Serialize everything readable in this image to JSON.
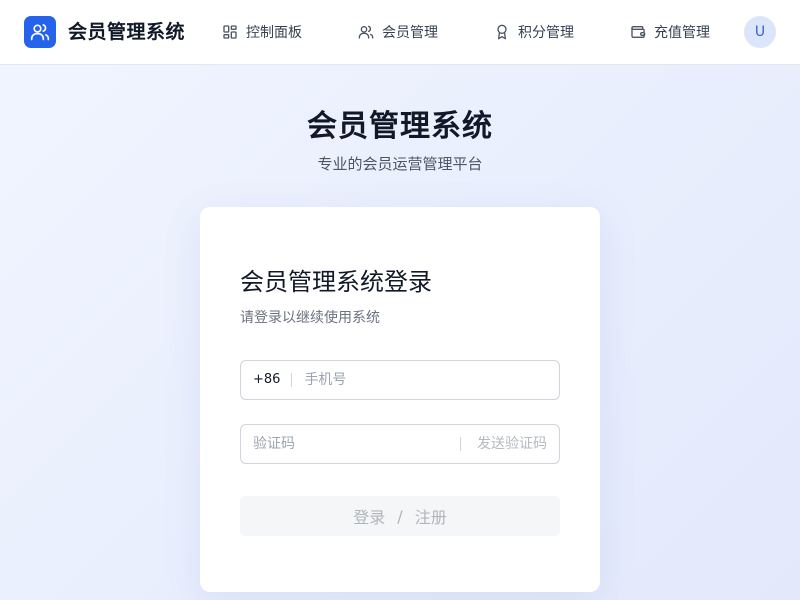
{
  "header": {
    "app_title": "会员管理系统",
    "logo_icon": "users-icon",
    "nav": [
      {
        "label": "控制面板",
        "icon": "dashboard-icon"
      },
      {
        "label": "会员管理",
        "icon": "users-icon"
      },
      {
        "label": "积分管理",
        "icon": "award-icon"
      },
      {
        "label": "充值管理",
        "icon": "wallet-icon"
      }
    ],
    "avatar_initial": "U"
  },
  "hero": {
    "title": "会员管理系统",
    "subtitle": "专业的会员运营管理平台"
  },
  "login": {
    "title": "会员管理系统登录",
    "subtitle": "请登录以继续使用系统",
    "phone_prefix": "+86",
    "phone_placeholder": "手机号",
    "phone_value": "",
    "code_placeholder": "验证码",
    "code_value": "",
    "send_code_label": "发送验证码",
    "submit_login_label": "登录",
    "submit_separator": "/",
    "submit_register_label": "注册"
  },
  "colors": {
    "accent": "#2563eb",
    "avatar_bg": "#dbe6fb",
    "disabled_button_bg": "#f5f6f8"
  }
}
